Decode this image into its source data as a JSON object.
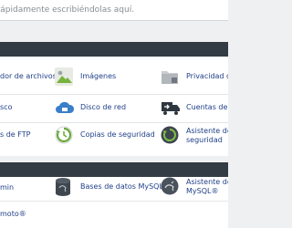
{
  "search": {
    "placeholder": "s rápidamente escribiéndolas aquí."
  },
  "files": {
    "items": [
      {
        "label": "dor de archivos"
      },
      {
        "label": "Imágenes"
      },
      {
        "label": "Privacidad del d"
      },
      {
        "label": "sco"
      },
      {
        "label": "Disco de red"
      },
      {
        "label": "Cuentas de FTP"
      },
      {
        "label": "s de FTP"
      },
      {
        "label": "Copias de seguridad"
      },
      {
        "label": "Asistente de cop"
      },
      {
        "label": "seguridad"
      }
    ]
  },
  "databases": {
    "items": [
      {
        "label": "min"
      },
      {
        "label": "Bases de datos MySQL®"
      },
      {
        "label": "Asistente de ba"
      },
      {
        "label": "MySQL®"
      },
      {
        "label": "moto®"
      }
    ]
  },
  "colors": {
    "link": "#1f3f88",
    "section_bar": "#333b45",
    "background": "#eef0f2"
  }
}
